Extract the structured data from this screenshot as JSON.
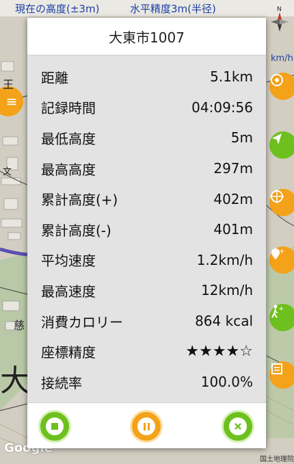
{
  "map": {
    "current_altitude_label": "現在の高度(±3m)",
    "horizontal_accuracy_label": "水平精度3m(半径)",
    "speed_unit": "km/h",
    "google_logo": "Google",
    "gsi_credit": "国土地理院",
    "compass_label": "N",
    "map_chars": [
      "王",
      "大",
      "文",
      "慈"
    ],
    "side_buttons": [
      {
        "icon": "compass-target-icon",
        "color": "#f3a21a"
      },
      {
        "icon": "navigation-arrow-icon",
        "color": "#6ec01e"
      },
      {
        "icon": "target-circle-icon",
        "color": "#f3a21a"
      },
      {
        "icon": "add-location-icon",
        "color": "#f3a21a"
      },
      {
        "icon": "walk-plus-icon",
        "color": "#6ec01e"
      },
      {
        "icon": "note-icon",
        "color": "#f3a21a"
      }
    ]
  },
  "dialog": {
    "title": "大東市1007",
    "rows": [
      {
        "label": "距離",
        "value": "5.1km"
      },
      {
        "label": "記録時間",
        "value": "04:09:56"
      },
      {
        "label": "最低高度",
        "value": "5m"
      },
      {
        "label": "最高高度",
        "value": "297m"
      },
      {
        "label": "累計高度(+)",
        "value": "402m"
      },
      {
        "label": "累計高度(-)",
        "value": "401m"
      },
      {
        "label": "平均速度",
        "value": "1.2km/h"
      },
      {
        "label": "最高速度",
        "value": "12km/h"
      },
      {
        "label": "消費カロリー",
        "value": "864 kcal"
      },
      {
        "label": "座標精度",
        "value": "★★★★☆"
      },
      {
        "label": "接続率",
        "value": "100.0%"
      }
    ],
    "accuracy_rating": 0.8,
    "buttons": {
      "stop": "stop-icon",
      "pause": "pause-icon",
      "close": "close-icon"
    }
  },
  "colors": {
    "green": "#6ec01e",
    "orange": "#f3a21a",
    "map_text_blue": "#1b3fa6"
  }
}
